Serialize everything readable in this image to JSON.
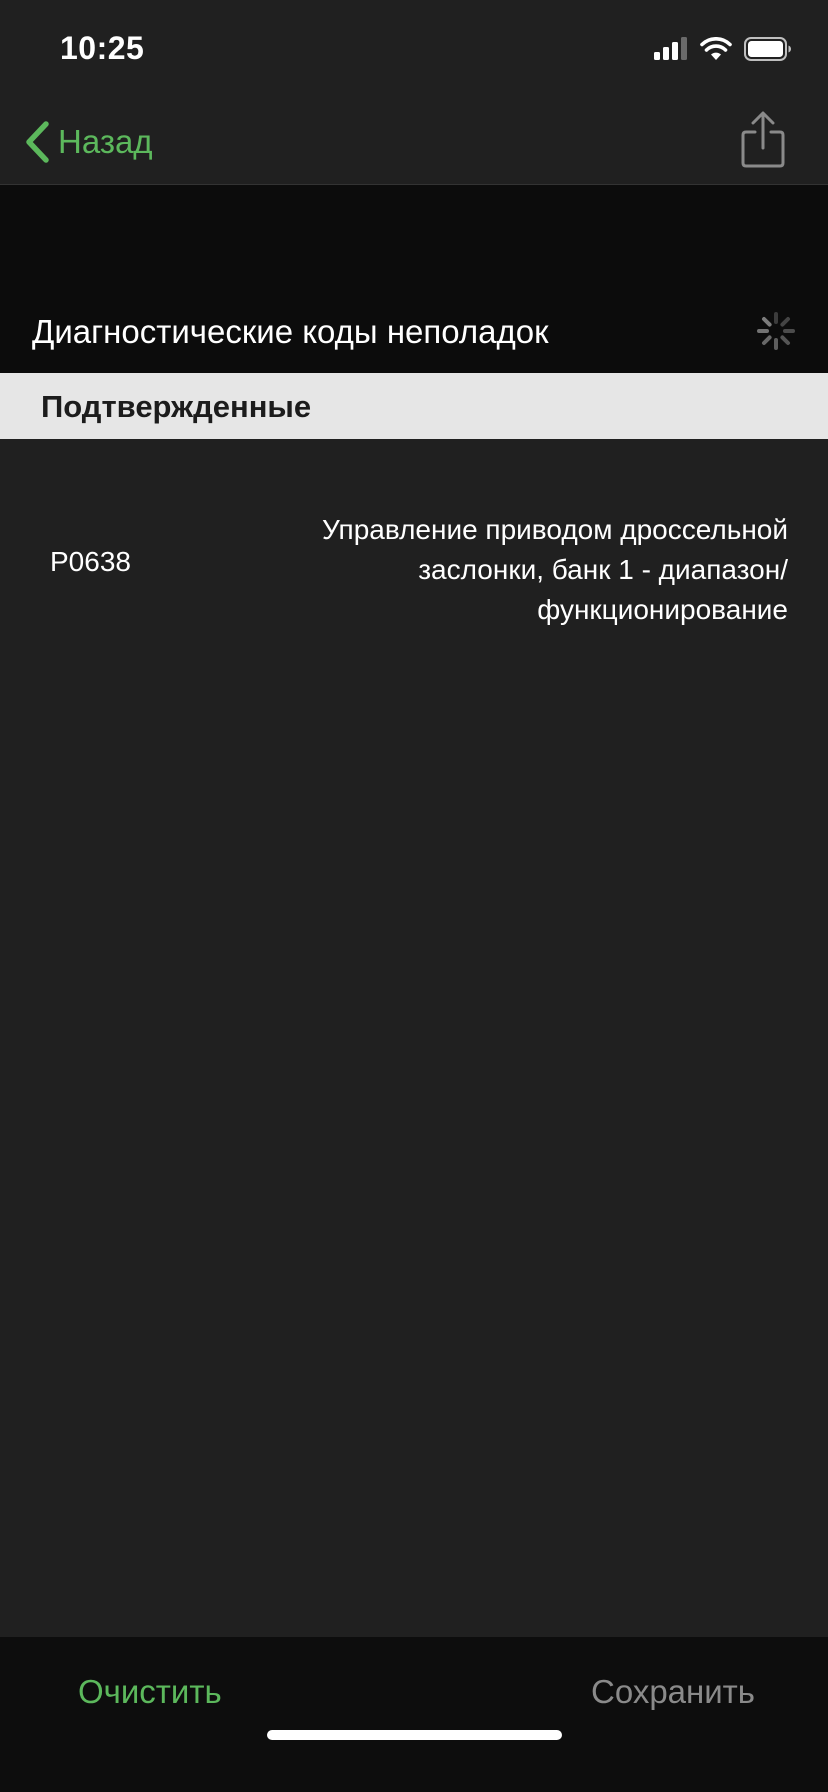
{
  "status_bar": {
    "time": "10:25",
    "icons": [
      "cellular-signal-icon",
      "wifi-icon",
      "battery-icon"
    ]
  },
  "nav": {
    "back_label": "Назад",
    "back_icon": "chevron-left-icon",
    "share_icon": "share-icon"
  },
  "header": {
    "title": "Диагностические коды неполадок",
    "activity_icon": "loading-spinner-icon"
  },
  "section": {
    "title": "Подтвержденные"
  },
  "codes": [
    {
      "code": "P0638",
      "description": "Управление приводом дроссельной заслонки, банк 1 - диапазон/ функционирование"
    }
  ],
  "toolbar": {
    "clear_label": "Очистить",
    "save_label": "Сохранить"
  },
  "colors": {
    "accent": "#5cb85c",
    "background": "#202020",
    "header_background": "#0c0c0c",
    "section_background": "#e6e6e6",
    "disabled_text": "#8a8a8a"
  }
}
